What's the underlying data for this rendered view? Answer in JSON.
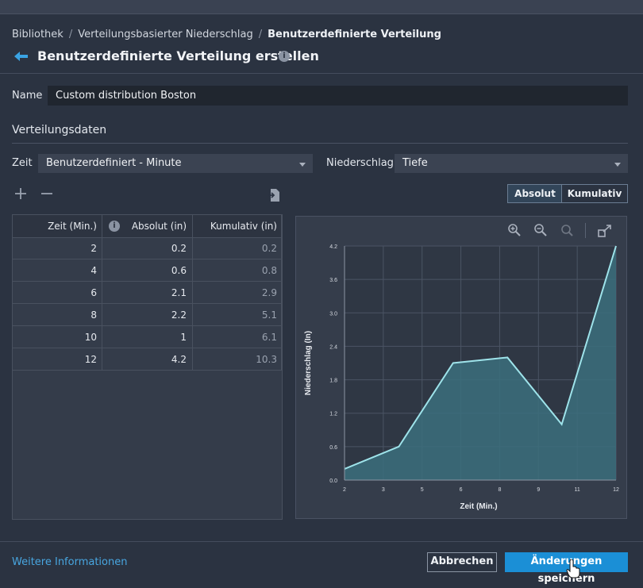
{
  "breadcrumb": [
    "Bibliothek",
    "Verteilungsbasierter Niederschlag",
    "Benutzerdefinierte Verteilung"
  ],
  "page_title": "Benutzerdefinierte Verteilung erstellen",
  "info_glyph": "i",
  "name_label": "Name",
  "name_value": "Custom distribution Boston",
  "section_title": "Verteilungsdaten",
  "time_label": "Zeit",
  "time_select": "Benutzerdefiniert - Minute",
  "precip_label": "Niederschlag",
  "precip_select": "Tiefe",
  "toggle": {
    "absolut": "Absolut",
    "kumulativ": "Kumulativ",
    "active": "Absolut"
  },
  "table": {
    "headers": [
      "Zeit (Min.)",
      "Absolut (in)",
      "Kumulativ (in)"
    ],
    "rows": [
      [
        "2",
        "0.2",
        "0.2"
      ],
      [
        "4",
        "0.6",
        "0.8"
      ],
      [
        "6",
        "2.1",
        "2.9"
      ],
      [
        "8",
        "2.2",
        "5.1"
      ],
      [
        "10",
        "1",
        "6.1"
      ],
      [
        "12",
        "4.2",
        "10.3"
      ]
    ]
  },
  "chart_data": {
    "type": "area",
    "x": [
      2,
      4,
      6,
      8,
      10,
      12
    ],
    "values": [
      0.2,
      0.6,
      2.1,
      2.2,
      1,
      4.2
    ],
    "xlabel": "Zeit (Min.)",
    "ylabel": "Niederschlag (In)",
    "x_ticks": [
      "2",
      "3",
      "5",
      "6",
      "8",
      "9",
      "11",
      "12"
    ],
    "y_ticks": [
      "0.0",
      "0.6",
      "1.2",
      "1.8",
      "2.4",
      "3.0",
      "3.6",
      "4.2"
    ],
    "ylim": [
      0,
      4.2
    ],
    "xlim": [
      2,
      12
    ],
    "grid": true,
    "line_color": "#9ee3ea",
    "fill_color": "#3b6e7c"
  },
  "chart_toolbar": [
    "zoom-in-icon",
    "zoom-out-icon",
    "reset-zoom-icon",
    "expand-icon"
  ],
  "footer": {
    "more_info": "Weitere Informationen",
    "cancel": "Abbrechen",
    "save": "Änderungen speichern"
  },
  "colors": {
    "accent": "#1b8fd6",
    "link": "#48a6e0",
    "background": "#2b3341"
  }
}
